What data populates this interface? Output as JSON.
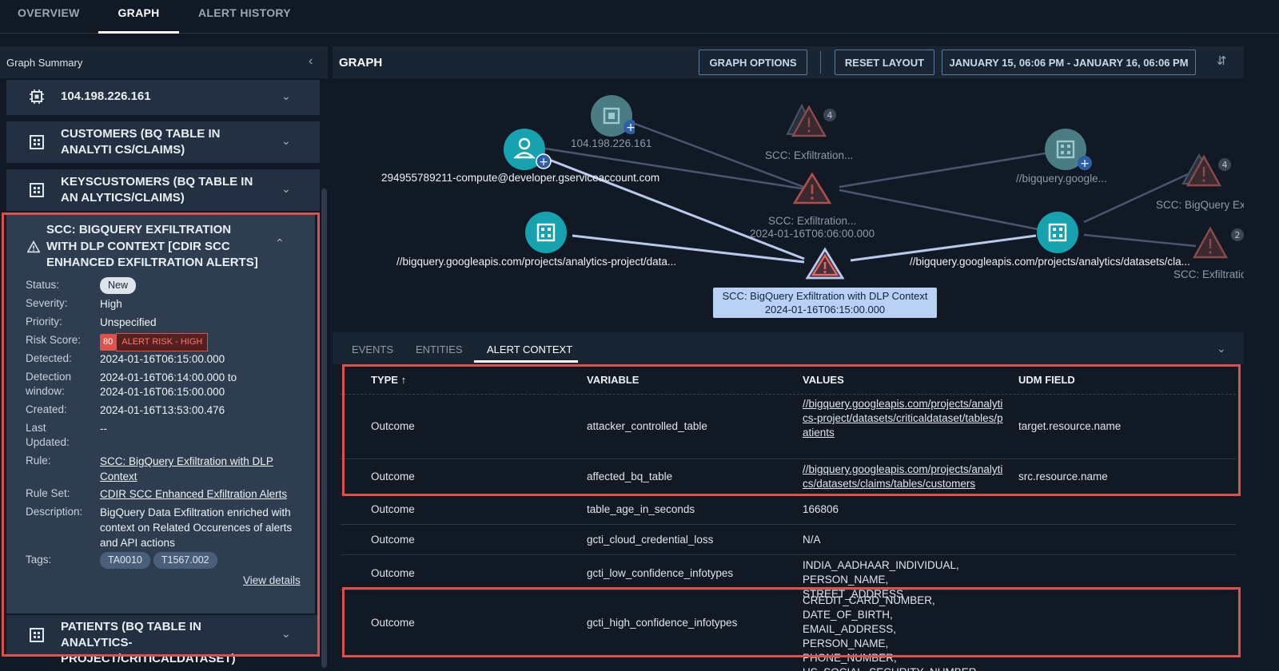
{
  "tabs": [
    "OVERVIEW",
    "GRAPH",
    "ALERT HISTORY"
  ],
  "sidebar": {
    "title": "Graph Summary",
    "items": [
      {
        "label": "104.198.226.161"
      },
      {
        "label": "CUSTOMERS (BQ TABLE IN ANALYTI CS/CLAIMS)"
      },
      {
        "label": "KEYSCUSTOMERS (BQ TABLE IN AN ALYTICS/CLAIMS)"
      },
      {
        "label": "SCC: BIGQUERY EXFILTRATION WITH DLP CONTEXT [CDIR SCC ENHANCED EXFILTRATION ALERTS]"
      },
      {
        "label": "PATIENTS (BQ TABLE IN ANALYTICS-PROJECT/CRITICALDATASET)"
      }
    ],
    "detail": {
      "status_label": "Status:",
      "status": "New",
      "severity_label": "Severity:",
      "severity": "High",
      "priority_label": "Priority:",
      "priority": "Unspecified",
      "risk_label": "Risk Score:",
      "risk_score": "80",
      "risk_level": "ALERT RISK - HIGH",
      "detected_label": "Detected:",
      "detected": "2024-01-16T06:15:00.000",
      "window_label1": "Detection",
      "window_label2": "window:",
      "window_line1": "2024-01-16T06:14:00.000 to",
      "window_line2": "2024-01-16T06:15:00.000",
      "created_label": "Created:",
      "created": "2024-01-16T13:53:00.476",
      "updated_label1": "Last",
      "updated_label2": "Updated:",
      "updated": "--",
      "rule_label": "Rule:",
      "rule": "SCC: BigQuery Exfiltration with DLP Context",
      "ruleset_label": "Rule Set:",
      "ruleset": "CDIR SCC Enhanced Exfiltration Alerts",
      "desc_label": "Description:",
      "description": "BigQuery Data Exfiltration enriched with context on Related Occurences of alerts and API actions",
      "tags_label": "Tags:",
      "tags": [
        "TA0010",
        "T1567.002"
      ],
      "view_details": "View details"
    }
  },
  "graph": {
    "title": "GRAPH",
    "options_btn": "GRAPH OPTIONS",
    "reset_btn": "RESET LAYOUT",
    "date_range": "JANUARY 15, 06:06 PM - JANUARY 16, 06:06 PM",
    "nodes": {
      "ip": "104.198.226.161",
      "account": "294955789211-compute@developer.gserviceaccount.com",
      "scc_top": "SCC: Exfiltration...",
      "scc_top_count": "4",
      "scc_mid": "SCC: Exfiltration...",
      "scc_mid_time": "2024-01-16T06:06:00.000",
      "bq_right_top": "//bigquery.google...",
      "scc_bq_ext": "SCC: BigQuery Ext",
      "scc_bq_ext_count": "4",
      "bq_left": "//bigquery.googleapis.com/projects/analytics-project/data...",
      "bq_right": "//bigquery.googleapis.com/projects/analytics/datasets/cla...",
      "scc_far_right": "SCC: Exfiltratio",
      "scc_far_right_count": "2",
      "selected": "SCC: BigQuery Exfiltration with DLP Context",
      "selected_time": "2024-01-16T06:15:00.000"
    }
  },
  "panel": {
    "tabs": [
      "EVENTS",
      "ENTITIES",
      "ALERT CONTEXT"
    ],
    "headers": [
      "TYPE ↑",
      "VARIABLE",
      "VALUES",
      "UDM FIELD"
    ],
    "rows": [
      {
        "type": "Outcome",
        "variable": "attacker_controlled_table",
        "values": "//bigquery.googleapis.com/projects/analytics-project/datasets/criticaldataset/tables/patients",
        "udm": "target.resource.name"
      },
      {
        "type": "Outcome",
        "variable": "affected_bq_table",
        "values": "//bigquery.googleapis.com/projects/analytics/datasets/claims/tables/customers",
        "udm": "src.resource.name"
      },
      {
        "type": "Outcome",
        "variable": "table_age_in_seconds",
        "values": "166806",
        "udm": ""
      },
      {
        "type": "Outcome",
        "variable": "gcti_cloud_credential_loss",
        "values": "N/A",
        "udm": ""
      },
      {
        "type": "Outcome",
        "variable": "gcti_low_confidence_infotypes",
        "values": "INDIA_AADHAAR_INDIVIDUAL, PERSON_NAME, STREET_ADDRESS",
        "udm": ""
      },
      {
        "type": "Outcome",
        "variable": "gcti_high_confidence_infotypes",
        "values": "CREDIT_CARD_NUMBER, DATE_OF_BIRTH, EMAIL_ADDRESS, PERSON_NAME, PHONE_NUMBER, US_SOCIAL_SECURITY_NUMBER",
        "udm": ""
      }
    ]
  },
  "colors": {
    "accent_teal": "#17a2b0",
    "highlight_red": "#e0504a",
    "alert_red": "#e15149"
  }
}
